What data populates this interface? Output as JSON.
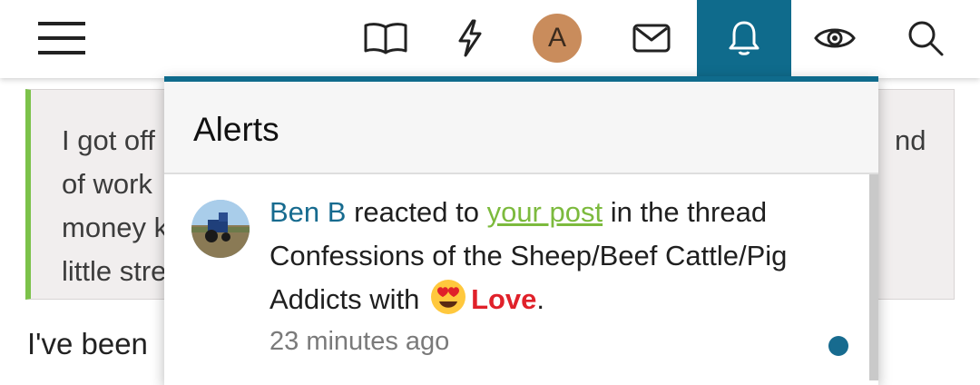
{
  "colors": {
    "accent": "#0f6b8c",
    "user_link": "#176b8f",
    "post_link": "#7cba3d",
    "love": "#e0212a",
    "quote_bar": "#7cc24a"
  },
  "nav": {
    "menu_icon": "hamburger-menu-icon",
    "items": [
      {
        "name": "book-icon"
      },
      {
        "name": "lightning-icon"
      },
      {
        "name": "avatar",
        "letter": "A"
      },
      {
        "name": "envelope-icon"
      },
      {
        "name": "bell-icon",
        "active": true
      },
      {
        "name": "eye-icon"
      },
      {
        "name": "search-icon"
      }
    ]
  },
  "background": {
    "quote_lines": [
      "I got off",
      "of work",
      "money k",
      "little stre"
    ],
    "quote_right": "nd",
    "body_text": "I've been"
  },
  "alerts": {
    "title": "Alerts",
    "items": [
      {
        "user": "Ben B",
        "text_reacted": "reacted to",
        "post_link": "your post",
        "text_thread": "in the thread",
        "thread_title": "Confessions of the Sheep/Beef Cattle/Pig Addicts",
        "text_with": "with",
        "reaction": "Love",
        "period": ".",
        "time": "23 minutes ago",
        "unread": true
      }
    ]
  }
}
